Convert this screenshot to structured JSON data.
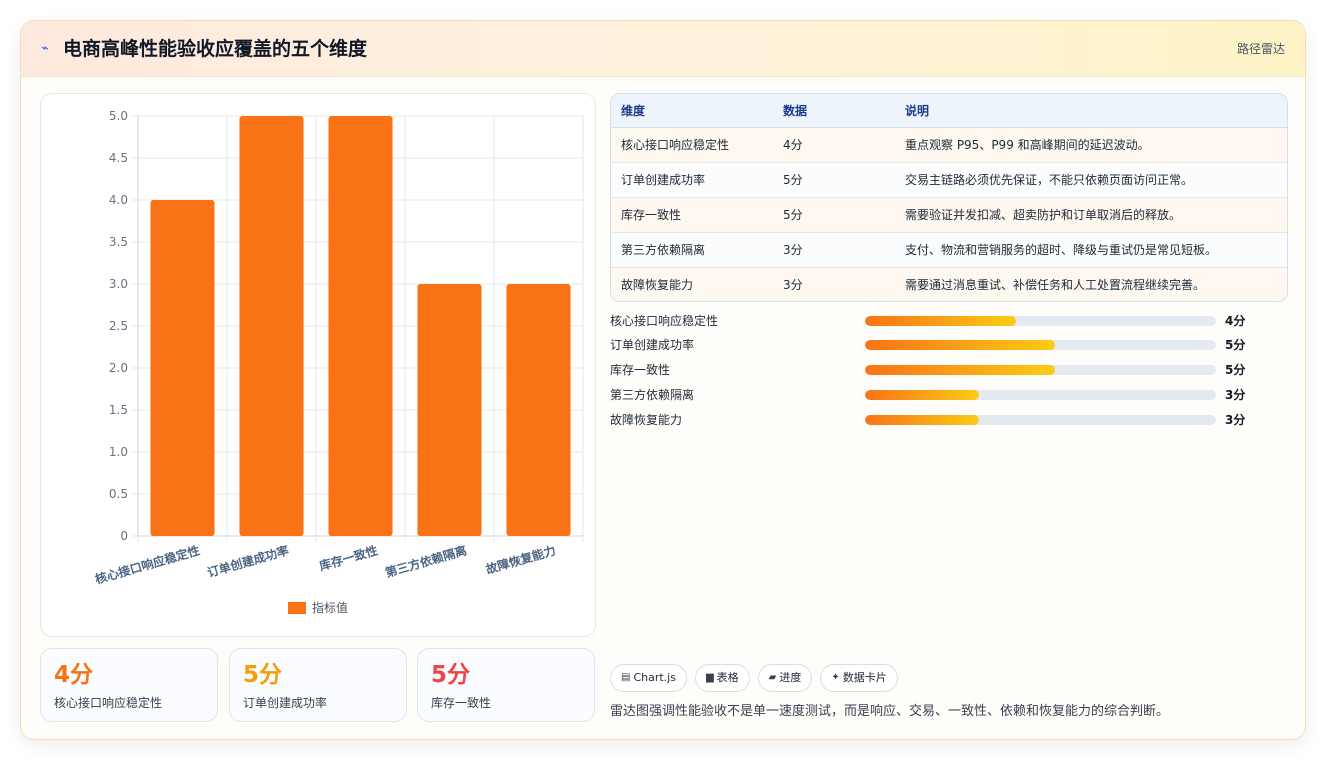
{
  "header": {
    "icon": "lightning-icon",
    "title": "电商高峰性能验收应覆盖的五个维度",
    "tag": "路径雷达"
  },
  "chart_data": {
    "type": "bar",
    "categories": [
      "核心接口响应稳定性",
      "订单创建成功率",
      "库存一致性",
      "第三方依赖隔离",
      "故障恢复能力"
    ],
    "series": [
      {
        "name": "指标值",
        "values": [
          4,
          5,
          5,
          3,
          3
        ],
        "color": "#f97316"
      }
    ],
    "yticks": [
      "0",
      "0.5",
      "1.0",
      "1.5",
      "2.0",
      "2.5",
      "3.0",
      "3.5",
      "4.0",
      "4.5",
      "5.0"
    ],
    "ylim": [
      0,
      5
    ],
    "grid": true,
    "legend": "bottom"
  },
  "stats": [
    {
      "value": "4分",
      "label": "核心接口响应稳定性",
      "color": "#f97316"
    },
    {
      "value": "5分",
      "label": "订单创建成功率",
      "color": "#f59e0b"
    },
    {
      "value": "5分",
      "label": "库存一致性",
      "color": "#ef4444"
    }
  ],
  "table": {
    "headers": [
      "维度",
      "数据",
      "说明"
    ],
    "rows": [
      [
        "核心接口响应稳定性",
        "4分",
        "重点观察 P95、P99 和高峰期间的延迟波动。"
      ],
      [
        "订单创建成功率",
        "5分",
        "交易主链路必须优先保证，不能只依赖页面访问正常。"
      ],
      [
        "库存一致性",
        "5分",
        "需要验证并发扣减、超卖防护和订单取消后的释放。"
      ],
      [
        "第三方依赖隔离",
        "3分",
        "支付、物流和营销服务的超时、降级与重试仍是常见短板。"
      ],
      [
        "故障恢复能力",
        "3分",
        "需要通过消息重试、补偿任务和人工处置流程继续完善。"
      ]
    ]
  },
  "progress": [
    {
      "label": "核心接口响应稳定性",
      "value": "4分",
      "fraction": 0.43
    },
    {
      "label": "订单创建成功率",
      "value": "5分",
      "fraction": 0.54
    },
    {
      "label": "库存一致性",
      "value": "5分",
      "fraction": 0.54
    },
    {
      "label": "第三方依赖隔离",
      "value": "3分",
      "fraction": 0.325
    },
    {
      "label": "故障恢复能力",
      "value": "3分",
      "fraction": 0.325
    }
  ],
  "chips": [
    {
      "icon": "chart-icon",
      "glyph": "▤",
      "label": "Chart.js"
    },
    {
      "icon": "table-icon",
      "glyph": "▆",
      "label": "表格"
    },
    {
      "icon": "progress-icon",
      "glyph": "▰",
      "label": "进度"
    },
    {
      "icon": "sparkle-icon",
      "glyph": "✦",
      "label": "数据卡片"
    }
  ],
  "footer_note": "雷达图强调性能验收不是单一速度测试，而是响应、交易、一致性、依赖和恢复能力的综合判断。"
}
